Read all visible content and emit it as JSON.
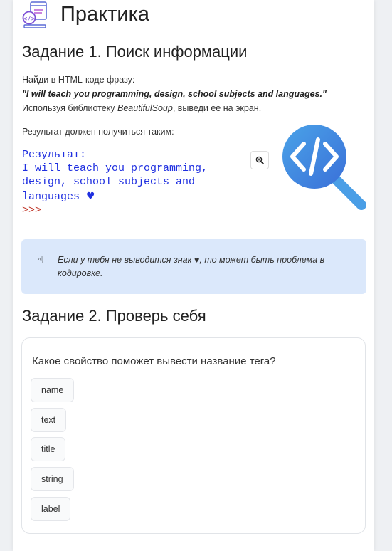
{
  "header": {
    "title": "Практика",
    "icon": "web-code-icon"
  },
  "task1": {
    "heading": "Задание 1. Поиск информации",
    "line1": "Найди в HTML-коде фразу:",
    "quote": "\"I will teach you programming, design, school subjects and languages.\"",
    "line3_prefix": "Используя библиотеку ",
    "line3_lib": "BeautifulSoup",
    "line3_suffix": ", выведи ее на экран.",
    "result_label": "Результат должен получиться таким:",
    "code": {
      "line1": "Результат:",
      "line2": "I will teach you programming,",
      "line3": "design, school subjects and",
      "line4": "languages ",
      "heart": "♥",
      "prompt": ">>>"
    },
    "zoom_icon": "zoom-in-icon",
    "logo_icon": "code-search-icon"
  },
  "note": {
    "icon": "pointing-hand-icon",
    "text": "Если у тебя не выводится знак ♥, то может быть проблема в кодировке."
  },
  "task2": {
    "heading": "Задание 2. Проверь себя",
    "question": "Какое свойство поможет вывести название тега?",
    "options": [
      "name",
      "text",
      "title",
      "string",
      "label"
    ]
  },
  "colors": {
    "accent": "#1f2fe0",
    "note_bg": "#dbe8fb",
    "logo_blue": "#3f8fe0"
  }
}
